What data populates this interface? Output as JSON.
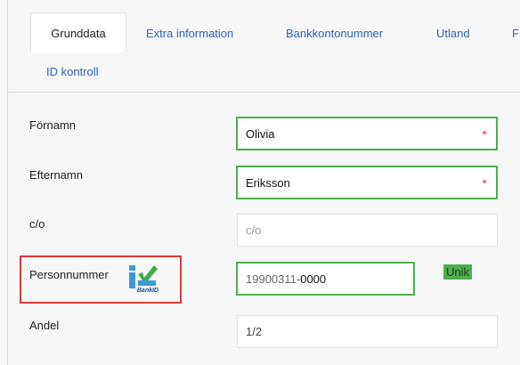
{
  "tabs": {
    "grunddata": "Grunddata",
    "extra": "Extra information",
    "bank": "Bankkontonummer",
    "utland": "Utland",
    "more": "F",
    "idkontroll": "ID kontroll"
  },
  "fields": {
    "fornamn": {
      "label": "Förnamn",
      "value": "Olivia",
      "required": "*"
    },
    "efternamn": {
      "label": "Efternamn",
      "value": "Eriksson",
      "required": "*"
    },
    "co": {
      "label": "c/o",
      "placeholder": "c/o"
    },
    "personnummer": {
      "label": "Personnummer",
      "value_prefix": "19900311-",
      "value_suffix": "0000",
      "badge": "Unik"
    },
    "andel": {
      "label": "Andel",
      "value": "1/2"
    }
  },
  "bankid": {
    "icon": "bankid-logo",
    "text": "BankID"
  },
  "colors": {
    "valid": "#4caf50",
    "highlight": "#d63b3b",
    "link": "#2b66b3",
    "required": "#e53935"
  }
}
